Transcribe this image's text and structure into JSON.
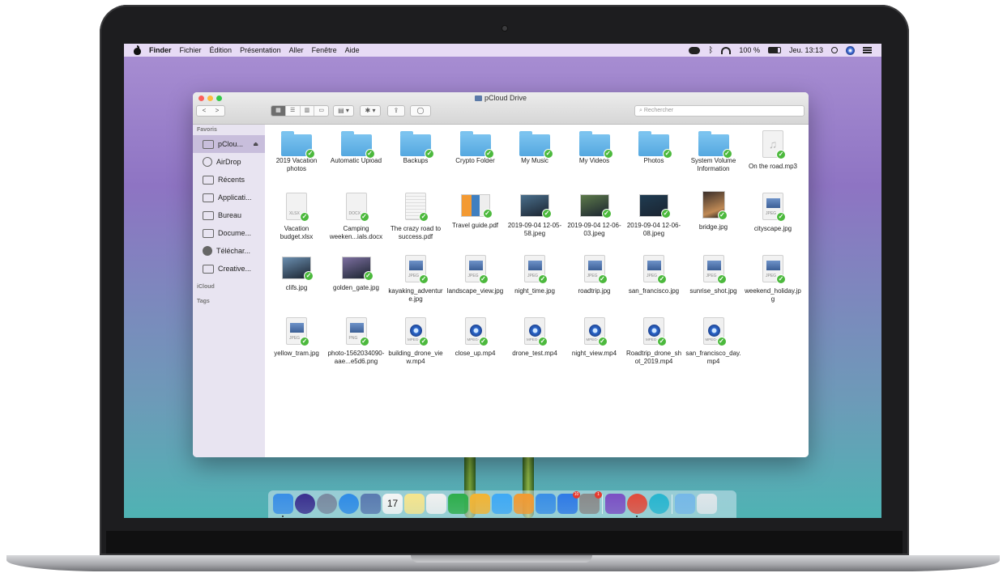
{
  "menubar": {
    "app_name": "Finder",
    "menus": [
      "Fichier",
      "Édition",
      "Présentation",
      "Aller",
      "Fenêtre",
      "Aide"
    ],
    "battery": "100 %",
    "clock": "Jeu. 13:13"
  },
  "window": {
    "title": "pCloud Drive",
    "search_placeholder": "Rechercher",
    "nav_back": "<",
    "nav_forward": ">"
  },
  "sidebar": {
    "favorites_header": "Favoris",
    "items": [
      {
        "label": "pClou...",
        "icon": "drive-icon",
        "active": true
      },
      {
        "label": "AirDrop",
        "icon": "airdrop-icon"
      },
      {
        "label": "Récents",
        "icon": "recents-icon"
      },
      {
        "label": "Applicati...",
        "icon": "applications-icon"
      },
      {
        "label": "Bureau",
        "icon": "desktop-icon"
      },
      {
        "label": "Docume...",
        "icon": "documents-icon"
      },
      {
        "label": "Téléchar...",
        "icon": "downloads-icon"
      },
      {
        "label": "Creative...",
        "icon": "folder-icon"
      }
    ],
    "icloud_header": "iCloud",
    "tags_header": "Tags"
  },
  "files": [
    {
      "name": "2019 Vacation photos",
      "kind": "folder"
    },
    {
      "name": "Automatic Upload",
      "kind": "folder"
    },
    {
      "name": "Backups",
      "kind": "folder"
    },
    {
      "name": "Crypto Folder",
      "kind": "folder"
    },
    {
      "name": "My Music",
      "kind": "folder"
    },
    {
      "name": "My Videos",
      "kind": "folder"
    },
    {
      "name": "Photos",
      "kind": "folder"
    },
    {
      "name": "System Volume Information",
      "kind": "folder"
    },
    {
      "name": "On the road.mp3",
      "kind": "audio"
    },
    {
      "name": "Vacation budget.xlsx",
      "kind": "doc",
      "tag": "XLSX"
    },
    {
      "name": "Camping weeken...ials.docx",
      "kind": "doc",
      "tag": "DOCX"
    },
    {
      "name": "The crazy road to success.pdf",
      "kind": "pdf"
    },
    {
      "name": "Travel guide.pdf",
      "kind": "pdf2"
    },
    {
      "name": "2019-09-04 12-05-58.jpeg",
      "kind": "photo",
      "color": "#4a6f8c"
    },
    {
      "name": "2019-09-04 12-06-03.jpeg",
      "kind": "photo",
      "color": "#5d7a4a"
    },
    {
      "name": "2019-09-04 12-06-08.jpeg",
      "kind": "photo",
      "color": "#1f3c52"
    },
    {
      "name": "bridge.jpg",
      "kind": "photo-tall",
      "color": "#3a2f2a"
    },
    {
      "name": "cityscape.jpg",
      "kind": "jpegdoc",
      "tag": "JPEG"
    },
    {
      "name": "clifs.jpg",
      "kind": "photo",
      "color": "#6b8fb0"
    },
    {
      "name": "golden_gate.jpg",
      "kind": "photo",
      "color": "#7d6fa0"
    },
    {
      "name": "kayaking_adventure.jpg",
      "kind": "jpegdoc",
      "tag": "JPEG"
    },
    {
      "name": "landscape_view.jpg",
      "kind": "jpegdoc",
      "tag": "JPEG"
    },
    {
      "name": "night_time.jpg",
      "kind": "jpegdoc",
      "tag": "JPEG"
    },
    {
      "name": "roadtrip.jpg",
      "kind": "jpegdoc",
      "tag": "JPEG"
    },
    {
      "name": "san_francisco.jpg",
      "kind": "jpegdoc",
      "tag": "JPEG"
    },
    {
      "name": "sunrise_shot.jpg",
      "kind": "jpegdoc",
      "tag": "JPEG"
    },
    {
      "name": "weekend_holiday.jpg",
      "kind": "jpegdoc",
      "tag": "JPEG"
    },
    {
      "name": "yellow_tram.jpg",
      "kind": "jpegdoc",
      "tag": "JPEG"
    },
    {
      "name": "photo-1562034090-aae...e5d6.png",
      "kind": "jpegdoc",
      "tag": "PNG"
    },
    {
      "name": "building_drone_view.mp4",
      "kind": "video",
      "tag": "MPEG-4"
    },
    {
      "name": "close_up.mp4",
      "kind": "video",
      "tag": "MPEG-4"
    },
    {
      "name": "drone_test.mp4",
      "kind": "video",
      "tag": "MPEG-4"
    },
    {
      "name": "night_view.mp4",
      "kind": "video",
      "tag": "MPEG-4"
    },
    {
      "name": "Roadtrip_drone_shot_2019.mp4",
      "kind": "video",
      "tag": "MPEG-4"
    },
    {
      "name": "san_francisco_day.mp4",
      "kind": "video",
      "tag": "MPEG-4"
    }
  ],
  "dock": {
    "apps": [
      {
        "name": "finder-icon",
        "color": "#3a8ee6"
      },
      {
        "name": "siri-icon",
        "color": "#3b2f8f"
      },
      {
        "name": "launchpad-icon",
        "color": "#7a8aa0"
      },
      {
        "name": "safari-icon",
        "color": "#2f8be6"
      },
      {
        "name": "preview-icon",
        "color": "#5a7ab0"
      },
      {
        "name": "calendar-icon",
        "color": "#f5f5f5",
        "label": "17"
      },
      {
        "name": "notes-icon",
        "color": "#f6e58d"
      },
      {
        "name": "reminders-icon",
        "color": "#f0f0f0"
      },
      {
        "name": "numbers-icon",
        "color": "#2eae4b"
      },
      {
        "name": "photos-icon",
        "color": "#f3b433"
      },
      {
        "name": "messages-icon",
        "color": "#3fa9f5"
      },
      {
        "name": "pages-icon",
        "color": "#f29a32"
      },
      {
        "name": "keynote-icon",
        "color": "#3a8ee6"
      },
      {
        "name": "app-store-icon",
        "color": "#2f7ae6",
        "badge": "10"
      },
      {
        "name": "system-preferences-icon",
        "color": "#8a8a8a",
        "badge": "1"
      },
      {
        "name": "viber-icon",
        "color": "#7c4fc4"
      },
      {
        "name": "chrome-icon",
        "color": "#e24a3b"
      },
      {
        "name": "pcloud-icon",
        "color": "#27b5cf"
      },
      {
        "name": "downloads-folder-icon",
        "color": "#76b8e8"
      },
      {
        "name": "trash-icon",
        "color": "#dfe6ea"
      }
    ]
  }
}
